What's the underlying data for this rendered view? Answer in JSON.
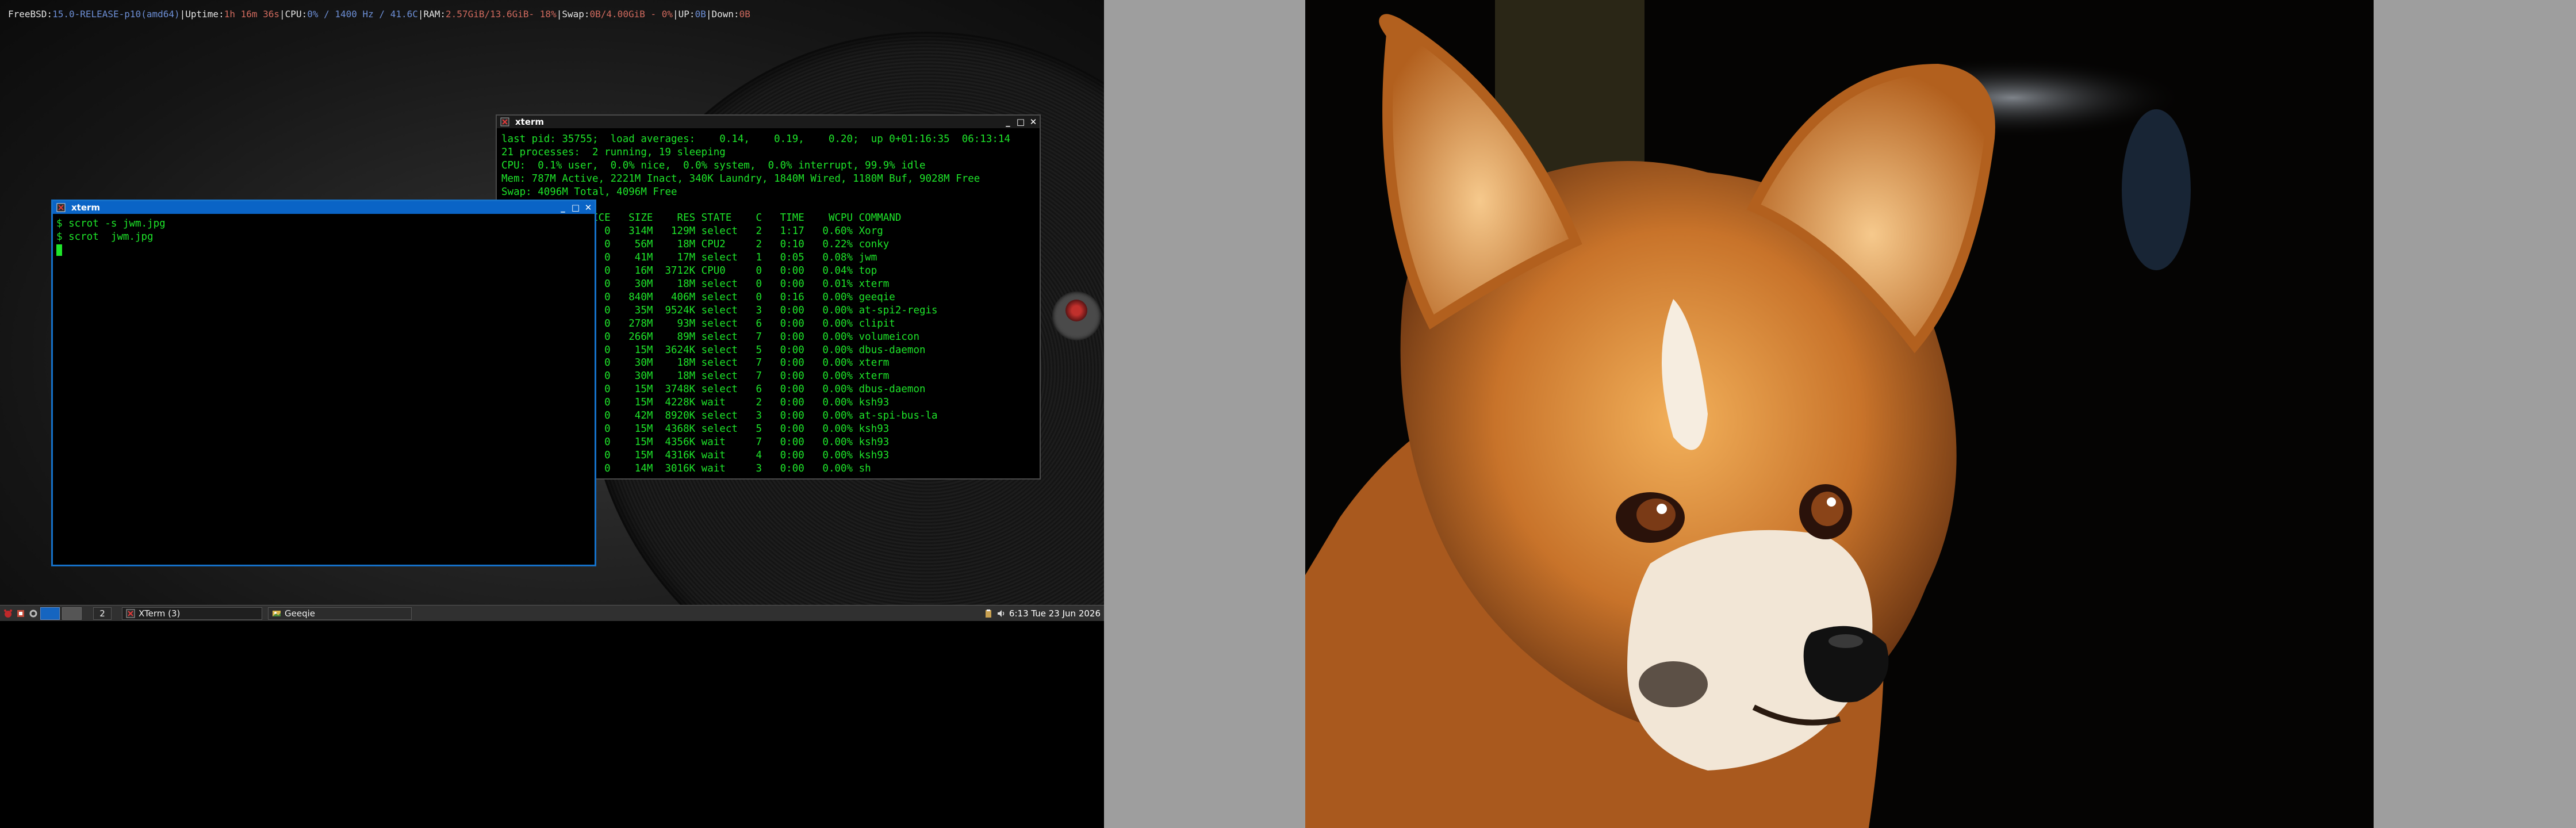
{
  "conky": {
    "os": "FreeBSD:",
    "release": "15.0-RELEASE-p10",
    "arch": "(amd64)",
    "sep": "|",
    "uptime_label": "Uptime:",
    "uptime_value": "1h 16m 36s",
    "cpu_label": "CPU:",
    "cpu_value": "0% / 1400 Hz / 41.6C",
    "ram_label": "RAM:",
    "ram_value": "2.57GiB/13.6GiB",
    "ram_pct": "- 18%",
    "swap_label": "Swap:",
    "swap_value": "0B/4.00GiB - 0%",
    "up_label": "UP:",
    "up_value": "0B",
    "down_label": "Down:",
    "down_value": "0B"
  },
  "xterm_top": {
    "title": "xterm",
    "header_lines": [
      "last pid: 35755;  load averages:    0.14,    0.19,    0.20;  up 0+01:16:35  06:13:14",
      "21 processes:  2 running, 19 sleeping",
      "CPU:  0.1% user,  0.0% nice,  0.0% system,  0.0% interrupt, 99.9% idle",
      "Mem: 787M Active, 2221M Inact, 340K Laundry, 1840M Wired, 1180M Buf, 9028M Free",
      "Swap: 4096M Total, 4096M Free"
    ],
    "table_header": "      THR PRI NICE   SIZE    RES STATE    C   TIME    WCPU COMMAND",
    "rows": [
      "       13   0    0   314M   129M select   2   1:17   0.60% Xorg",
      "        8   0    0    56M    18M CPU2     2   0:10   0.22% conky",
      "        2   0    0    41M    17M select   1   0:05   0.08% jwm",
      "        1   0    0    16M  3712K CPU0     0   0:00   0.04% top",
      "        1   0    0    30M    18M select   0   0:00   0.01% xterm",
      "       15   0    0   840M   406M select   0   0:16   0.00% geeqie",
      "        4   0    0    35M  9524K select   3   0:00   0.00% at-spi2-regis",
      "       12   0    0   278M    93M select   6   0:00   0.00% clipit",
      "       12   0    0   266M    89M select   7   0:00   0.00% volumeicon",
      "        1   0    0    15M  3624K select   5   0:00   0.00% dbus-daemon",
      "        1   0    0    30M    18M select   7   0:00   0.00% xterm",
      "        1   0    0    30M    18M select   7   0:00   0.00% xterm",
      "        1   0    0    15M  3748K select   6   0:00   0.00% dbus-daemon",
      "        1   0    0    15M  4228K wait     2   0:00   0.00% ksh93",
      "        5   0    0    42M  8920K select   3   0:00   0.00% at-spi-bus-la",
      "        1   0    0    15M  4368K select   5   0:00   0.00% ksh93",
      "        1   0    0    15M  4356K wait     7   0:00   0.00% ksh93",
      "        1   0    0    15M  4316K wait     4   0:00   0.00% ksh93",
      "        1  59    0    14M  3016K wait     3   0:00   0.00% sh"
    ]
  },
  "xterm_left": {
    "title": "xterm",
    "lines": [
      "$ scrot -s jwm.jpg",
      "$ scrot  jwm.jpg"
    ]
  },
  "taskbar": {
    "desktop_active": "",
    "desktop_2": "2",
    "task_xterm": "XTerm (3)",
    "task_geeqie": "Geeqie",
    "clock": "6:13 Tue 23 Jun 2026"
  },
  "window_buttons": {
    "minimize": "_",
    "maximize": "□",
    "close": "✕"
  },
  "colors": {
    "terminal_text": "#1ee62a",
    "active_title": "#0a64c6",
    "inactive_title": "#1b1b1b",
    "conky_blue": "#6d8fd6",
    "conky_red": "#d06a5e",
    "taskbar": "#303030"
  }
}
